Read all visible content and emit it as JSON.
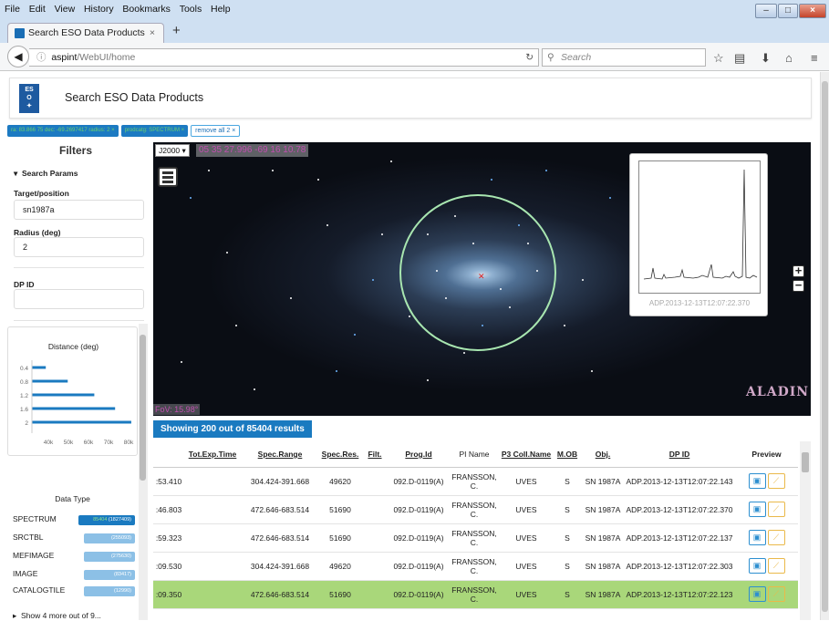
{
  "browser": {
    "menu": [
      "File",
      "Edit",
      "View",
      "History",
      "Bookmarks",
      "Tools",
      "Help"
    ],
    "tab_title": "Search ESO Data Products",
    "tab_close": "×",
    "new_tab": "+",
    "url_host": "aspint",
    "url_path": "/WebUI/home",
    "search_placeholder": "Search"
  },
  "app": {
    "title": "Search ESO Data Products",
    "logo_text": "ES O"
  },
  "chips": [
    {
      "label": "ra: 83.866 75 dec: -69.2697417 radius: 2 ×"
    },
    {
      "label": "prodcatg: SPECTRUM ×"
    },
    {
      "label": "remove all 2 ×"
    }
  ],
  "sidebar": {
    "title": "Filters",
    "search_params": "Search Params",
    "target_label": "Target/position",
    "target_value": "sn1987a",
    "radius_label": "Radius (deg)",
    "radius_value": "2",
    "dpid_label": "DP ID",
    "dpid_value": "",
    "distance_title": "Distance (deg)",
    "distance_yticks": [
      "0.4",
      "0.8",
      "1.2",
      "1.6",
      "2"
    ],
    "distance_xticks": [
      "40k",
      "50k",
      "60k",
      "70k",
      "80k"
    ],
    "distance_values": [
      12000,
      31000,
      54000,
      72000,
      86000
    ],
    "datatype_title": "Data Type",
    "datatypes": [
      {
        "label": "SPECTRUM",
        "count": "85404",
        "total": "(1827409)"
      },
      {
        "label": "SRCTBL",
        "count": "",
        "total": "(255093)"
      },
      {
        "label": "MEFIMAGE",
        "count": "",
        "total": "(275630)"
      },
      {
        "label": "IMAGE",
        "count": "",
        "total": "(83417)"
      },
      {
        "label": "CATALOGTILE",
        "count": "",
        "total": "(12990)"
      }
    ],
    "show_more": "Show 4 more out of 9..."
  },
  "sky": {
    "frame": "J2000",
    "coords": "05 35 27.996 -69 16 10.78",
    "fov": "FoV: 15.98°",
    "preview_caption": "ADP.2013-12-13T12:07:22.370",
    "zoom_in": "+",
    "zoom_out": "−",
    "brand": "ALADIN"
  },
  "results": {
    "summary": "Showing 200 out of 85404 results",
    "headers": [
      "",
      "Tot.Exp.Time",
      "Spec.Range",
      "Spec.Res.",
      "Filt.",
      "Prog.Id",
      "PI Name",
      "P3 Coll.Name",
      "M.OB",
      "Obj.",
      "DP ID",
      "Preview"
    ],
    "rows": [
      [
        ":53.410",
        "",
        "304.424-391.668",
        "49620",
        "",
        "092.D-0119(A)",
        "FRANSSON, C.",
        "UVES",
        "S",
        "SN 1987A",
        "ADP.2013-12-13T12:07:22.143"
      ],
      [
        ":46.803",
        "",
        "472.646-683.514",
        "51690",
        "",
        "092.D-0119(A)",
        "FRANSSON, C.",
        "UVES",
        "S",
        "SN 1987A",
        "ADP.2013-12-13T12:07:22.370"
      ],
      [
        ":59.323",
        "",
        "472.646-683.514",
        "51690",
        "",
        "092.D-0119(A)",
        "FRANSSON, C.",
        "UVES",
        "S",
        "SN 1987A",
        "ADP.2013-12-13T12:07:22.137"
      ],
      [
        ":09.530",
        "",
        "304.424-391.668",
        "49620",
        "",
        "092.D-0119(A)",
        "FRANSSON, C.",
        "UVES",
        "S",
        "SN 1987A",
        "ADP.2013-12-13T12:07:22.303"
      ],
      [
        ":09.350",
        "",
        "472.646-683.514",
        "51690",
        "",
        "092.D-0119(A)",
        "FRANSSON, C.",
        "UVES",
        "S",
        "SN 1987A",
        "ADP.2013-12-13T12:07:22.123"
      ]
    ],
    "highlight_row": 4
  },
  "colors": {
    "accent": "#1a7ac0",
    "highlight": "#a9d77a",
    "fov": "#c14fb0"
  }
}
